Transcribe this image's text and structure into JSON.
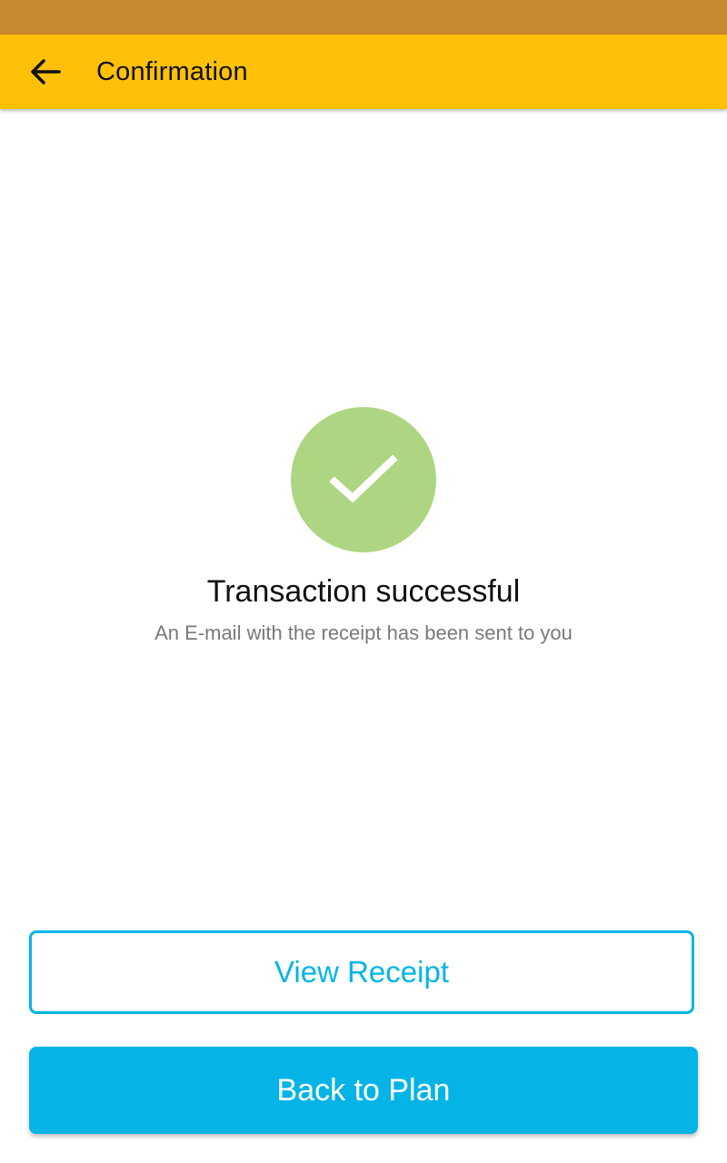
{
  "app_bar": {
    "title": "Confirmation",
    "back_icon": "arrow-left-icon"
  },
  "result": {
    "icon": "check-icon",
    "title": "Transaction successful",
    "subtitle": "An E-mail with the receipt has been sent to you"
  },
  "actions": {
    "view_receipt_label": "View Receipt",
    "back_to_plan_label": "Back to Plan"
  },
  "colors": {
    "status_bar": "#c8882e",
    "app_bar": "#ffc107",
    "success": "#aed581",
    "accent": "#04b4e6"
  }
}
